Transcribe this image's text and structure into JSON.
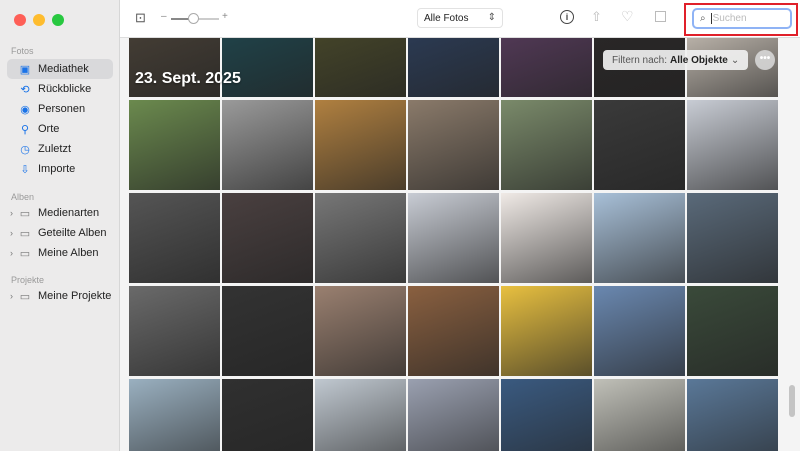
{
  "sidebar": {
    "sections": [
      "Fotos",
      "Alben",
      "Projekte"
    ],
    "fotos": [
      {
        "label": "Mediathek",
        "icon": "photo-library-icon"
      },
      {
        "label": "Rückblicke",
        "icon": "memories-icon"
      },
      {
        "label": "Personen",
        "icon": "people-icon"
      },
      {
        "label": "Orte",
        "icon": "places-icon"
      },
      {
        "label": "Zuletzt",
        "icon": "recent-icon"
      },
      {
        "label": "Importe",
        "icon": "import-icon"
      }
    ],
    "alben": [
      {
        "label": "Medienarten"
      },
      {
        "label": "Geteilte Alben"
      },
      {
        "label": "Meine Alben"
      }
    ],
    "projekte": [
      {
        "label": "Meine Projekte"
      }
    ]
  },
  "toolbar": {
    "view_select": "Alle Fotos",
    "search_placeholder": "Suchen",
    "zoom_minus": "–",
    "zoom_plus": "+",
    "zoom_level": 0.4
  },
  "grid": {
    "date": "23. Sept. 2025",
    "filter_label": "Filtern nach:",
    "filter_value": "Alle Objekte",
    "more": "•••"
  },
  "colors": {
    "accent": "#1a73e8",
    "highlight": "#e0202a"
  }
}
